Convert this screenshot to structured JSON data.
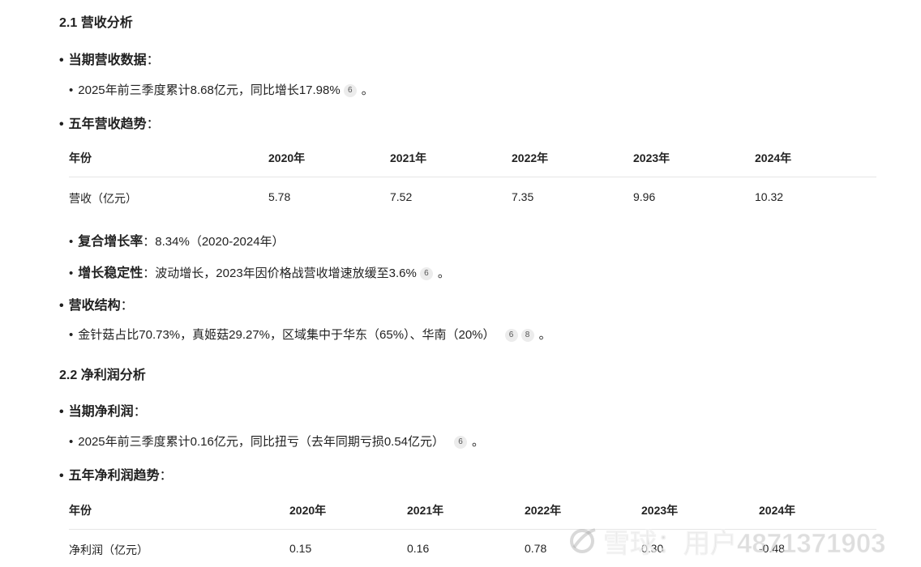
{
  "section1": {
    "heading": "2.1 营收分析",
    "current_label": "当期营收数据",
    "current_text": "2025年前三季度累计8.68亿元，同比增长17.98%",
    "current_cites": [
      "6"
    ],
    "trend_label": "五年营收趋势",
    "table": {
      "headers": [
        "年份",
        "2020年",
        "2021年",
        "2022年",
        "2023年",
        "2024年"
      ],
      "row": [
        "营收（亿元）",
        "5.78",
        "7.52",
        "7.35",
        "9.96",
        "10.32"
      ]
    },
    "cagr_label": "复合增长率",
    "cagr_text": "8.34%（2020-2024年）",
    "stability_label": "增长稳定性",
    "stability_text": "波动增长，2023年因价格战营收增速放缓至3.6%",
    "stability_cites": [
      "6"
    ],
    "structure_label": "营收结构",
    "structure_text": "金针菇占比70.73%，真姬菇29.27%，区域集中于华东（65%）、华南（20%）",
    "structure_cites": [
      "6",
      "8"
    ]
  },
  "section2": {
    "heading": "2.2 净利润分析",
    "current_label": "当期净利润",
    "current_text": "2025年前三季度累计0.16亿元，同比扭亏（去年同期亏损0.54亿元）",
    "current_cites": [
      "6"
    ],
    "trend_label": "五年净利润趋势",
    "table": {
      "headers": [
        "年份",
        "2020年",
        "2021年",
        "2022年",
        "2023年",
        "2024年"
      ],
      "row": [
        "净利润（亿元）",
        "0.15",
        "0.16",
        "0.78",
        "0.30",
        "-0.48"
      ]
    }
  },
  "punct": {
    "colon": "：",
    "period": "。",
    "bullet": "•"
  },
  "watermark": "雪球：用户4871371903"
}
